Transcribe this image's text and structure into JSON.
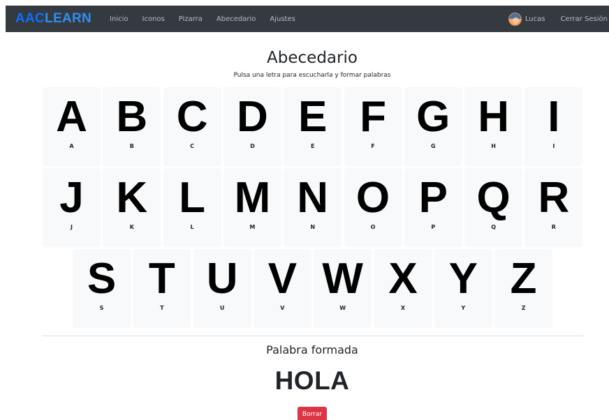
{
  "navbar": {
    "brand_part1": "AAC",
    "brand_part2": "LEARN",
    "links": [
      "Inicio",
      "Iconos",
      "Pizarra",
      "Abecedario",
      "Ajustes"
    ],
    "user_name": "Lucas",
    "logout_label": "Cerrar Sesión",
    "avatar_icon": "user-avatar-icon"
  },
  "page": {
    "title": "Abecedario",
    "subtitle": "Pulsa una letra para escucharla y formar palabras"
  },
  "letters": {
    "row1": [
      {
        "big": "A",
        "small": "A"
      },
      {
        "big": "B",
        "small": "B"
      },
      {
        "big": "C",
        "small": "C"
      },
      {
        "big": "D",
        "small": "D"
      },
      {
        "big": "E",
        "small": "E"
      },
      {
        "big": "F",
        "small": "F"
      },
      {
        "big": "G",
        "small": "G"
      },
      {
        "big": "H",
        "small": "H"
      },
      {
        "big": "I",
        "small": "I"
      }
    ],
    "row2": [
      {
        "big": "J",
        "small": "J"
      },
      {
        "big": "K",
        "small": "K"
      },
      {
        "big": "L",
        "small": "L"
      },
      {
        "big": "M",
        "small": "M"
      },
      {
        "big": "N",
        "small": "N"
      },
      {
        "big": "O",
        "small": "O"
      },
      {
        "big": "P",
        "small": "P"
      },
      {
        "big": "Q",
        "small": "Q"
      },
      {
        "big": "R",
        "small": "R"
      }
    ],
    "row3": [
      {
        "big": "S",
        "small": "S"
      },
      {
        "big": "T",
        "small": "T"
      },
      {
        "big": "U",
        "small": "U"
      },
      {
        "big": "V",
        "small": "V"
      },
      {
        "big": "W",
        "small": "W"
      },
      {
        "big": "X",
        "small": "X"
      },
      {
        "big": "Y",
        "small": "Y"
      },
      {
        "big": "Z",
        "small": "Z"
      }
    ]
  },
  "word_section": {
    "title": "Palabra formada",
    "word": "HOLA",
    "clear_label": "Borrar"
  },
  "colors": {
    "navbar_bg": "#343a40",
    "brand_blue": "#0d6efd",
    "card_bg": "#f8f9fa",
    "danger": "#dc3545"
  }
}
